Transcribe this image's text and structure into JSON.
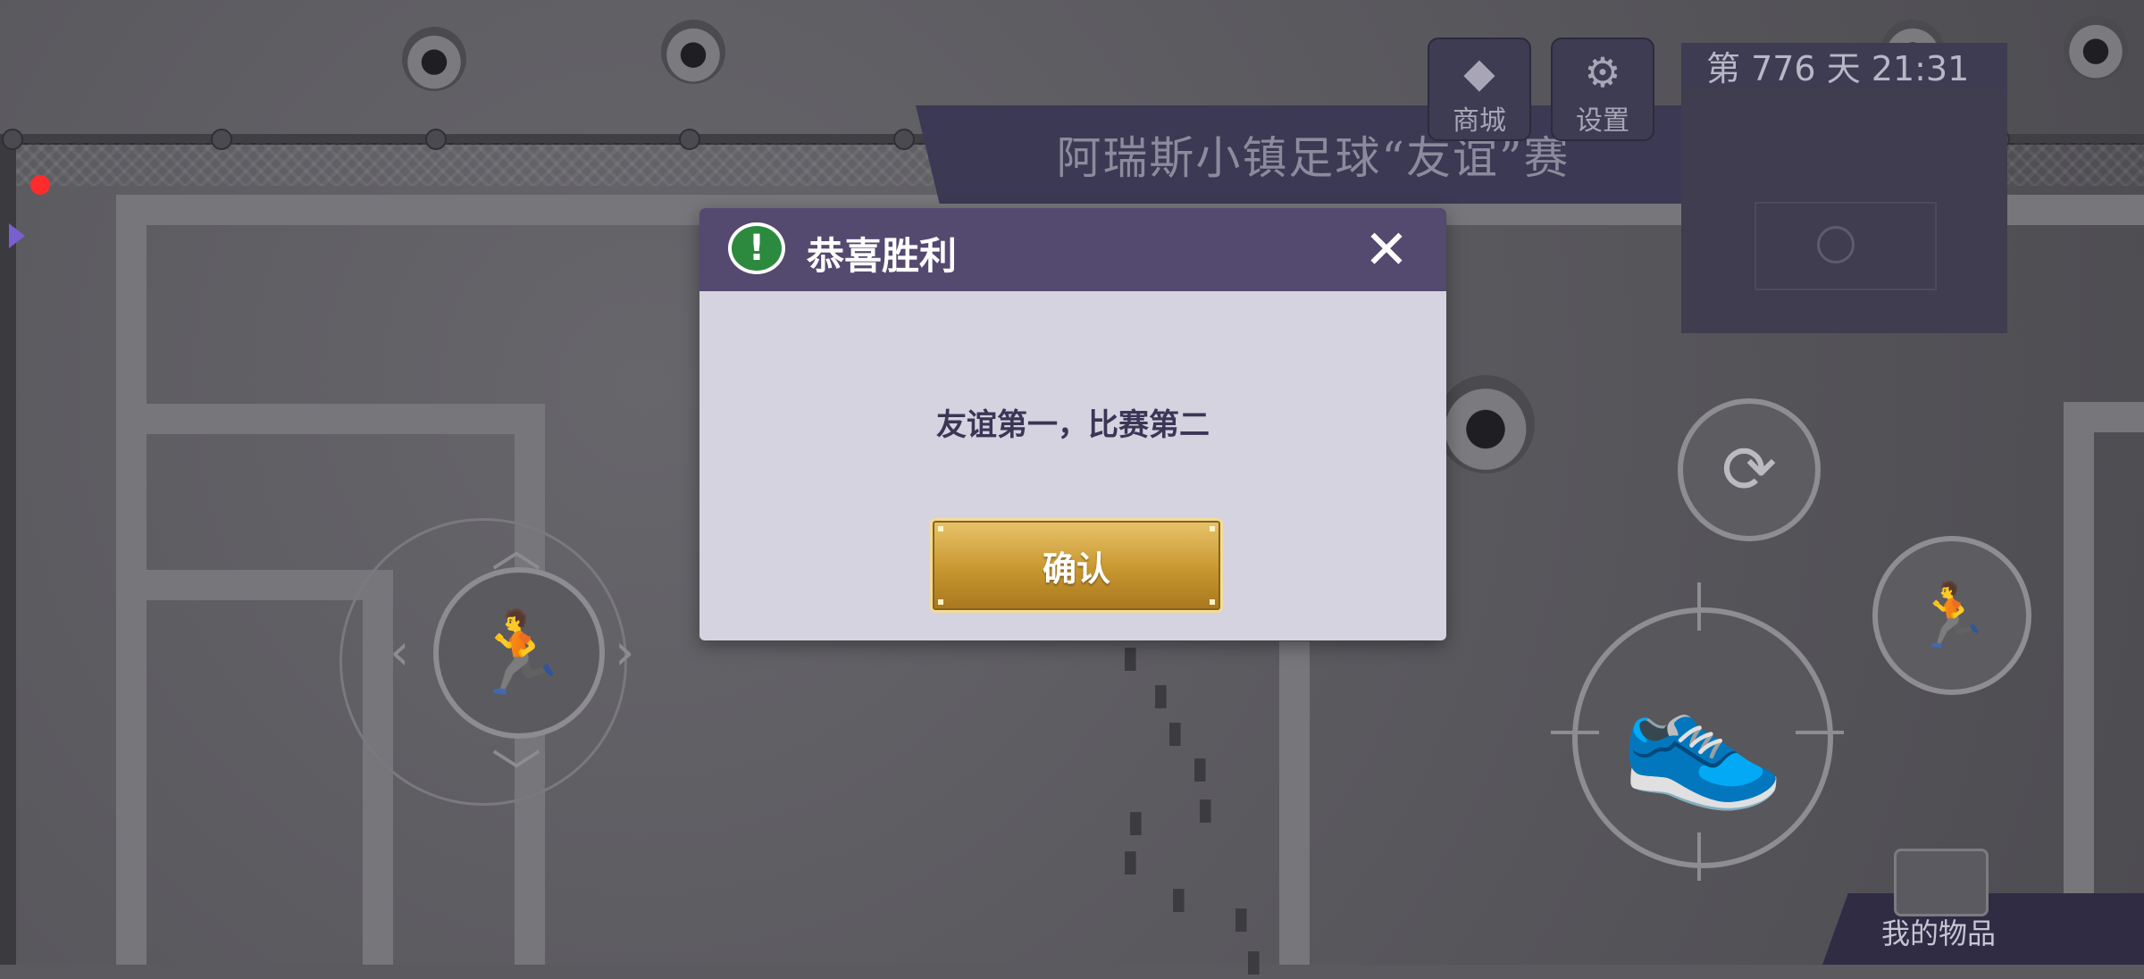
{
  "hud": {
    "shop_label": "商城",
    "settings_label": "设置",
    "day_time": "第 776 天  21:31",
    "items_label": "我的物品",
    "shop_icon": "diamond-icon",
    "settings_icon": "gear-icon"
  },
  "banner": {
    "text": "阿瑞斯小镇足球“友谊”赛"
  },
  "dialog": {
    "title": "恭喜胜利",
    "message": "友谊第一，比赛第二",
    "confirm_label": "确认",
    "header_color": "#54496f",
    "button_color": "#c8962f"
  }
}
